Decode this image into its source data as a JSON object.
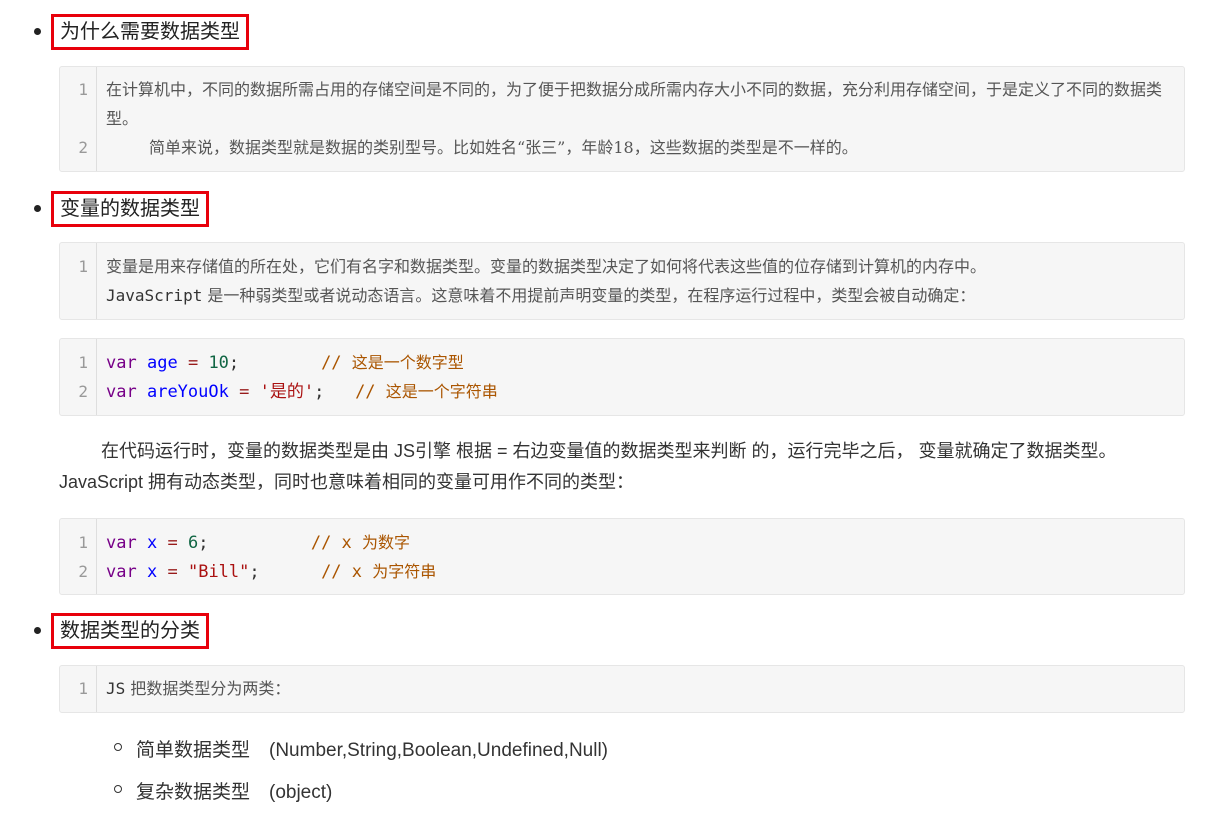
{
  "sections": [
    {
      "title": "为什么需要数据类型"
    },
    {
      "title": "变量的数据类型"
    },
    {
      "title": "数据类型的分类"
    }
  ],
  "block1": {
    "nums": [
      "1",
      "2"
    ],
    "line1": "在计算机中，不同的数据所需占用的存储空间是不同的，为了便于把数据分成所需内存大小不同的数据，充分利用存储空间，于是定义了不同的数据类型。",
    "line2": "简单来说，数据类型就是数据的类别型号。比如姓名“张三”，年龄18，这些数据的类型是不一样的。"
  },
  "block2": {
    "nums": [
      "1"
    ],
    "line1": "变量是用来存储值的所在处，它们有名字和数据类型。变量的数据类型决定了如何将代表这些值的位存储到计算机的内存中。",
    "line1b_mono": "JavaScript",
    "line1b_rest": " 是一种弱类型或者说动态语言。这意味着不用提前声明变量的类型，在程序运行过程中，类型会被自动确定："
  },
  "code1": {
    "nums": [
      "1",
      "2"
    ],
    "l1": {
      "kw": "var",
      "name": "age",
      "op": "=",
      "val": "10",
      "end": ";",
      "comment_slash": "//",
      "comment": "这是一个数字型"
    },
    "l2": {
      "kw": "var",
      "name": "areYouOk",
      "op": "=",
      "val": "'是的'",
      "end": ";",
      "comment_slash": "//",
      "comment": "这是一个字符串"
    }
  },
  "para": {
    "text": "在代码运行时，变量的数据类型是由 JS引擎 根据 = 右边变量值的数据类型来判断 的，运行完毕之后， 变量就确定了数据类型。JavaScript 拥有动态类型，同时也意味着相同的变量可用作不同的类型："
  },
  "code2": {
    "nums": [
      "1",
      "2"
    ],
    "l1": {
      "kw": "var",
      "name": "x",
      "op": "=",
      "val": "6",
      "end": ";",
      "comment_slash": "// x",
      "comment": "为数字"
    },
    "l2": {
      "kw": "var",
      "name": "x",
      "op": "=",
      "val": "\"Bill\"",
      "end": ";",
      "comment_slash": "// x",
      "comment": "为字符串"
    }
  },
  "block3": {
    "nums": [
      "1"
    ],
    "mono": "JS",
    "rest": " 把数据类型分为两类："
  },
  "sub_items": [
    "简单数据类型　(Number,String,Boolean,Undefined,Null)",
    "复杂数据类型　(object)"
  ]
}
